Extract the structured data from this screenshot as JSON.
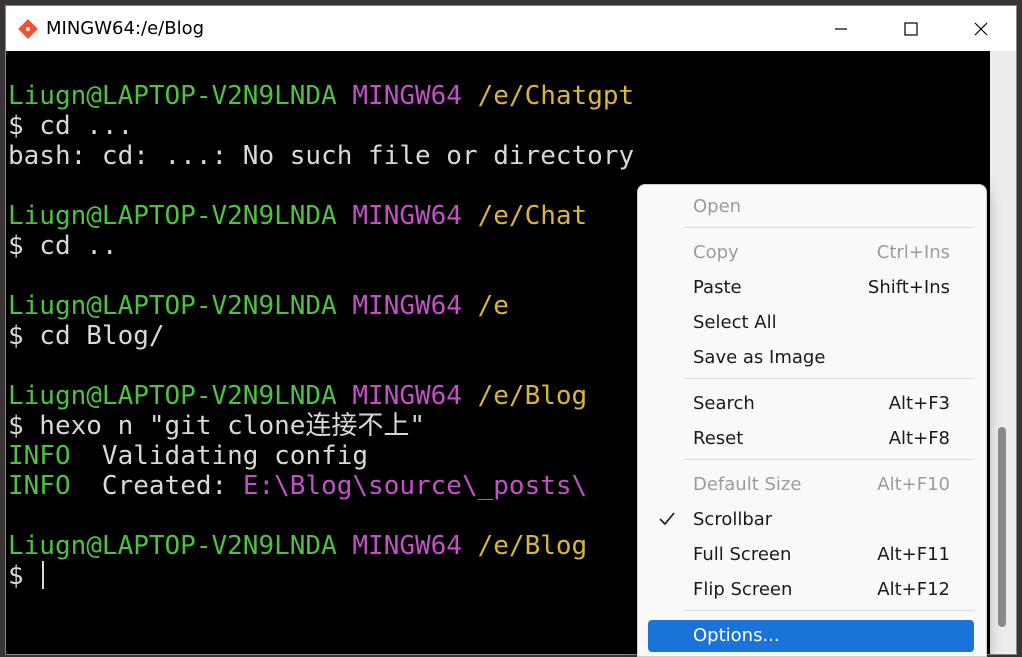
{
  "window": {
    "title": "MINGW64:/e/Blog",
    "minimize_icon": "minimize-icon",
    "maximize_icon": "maximize-icon",
    "close_icon": "close-icon"
  },
  "terminal": {
    "lines": [
      {
        "segments": [
          {
            "text": "Liugn@LAPTOP-V2N9LNDA",
            "color": "green"
          },
          {
            "text": " MINGW64",
            "color": "magenta"
          },
          {
            "text": " /e/Chatgpt",
            "color": "yellow"
          }
        ]
      },
      {
        "segments": [
          {
            "text": "$ cd ...",
            "color": "white"
          }
        ]
      },
      {
        "segments": [
          {
            "text": "bash: cd: ...: No such file or directory",
            "color": "white"
          }
        ]
      },
      {
        "segments": []
      },
      {
        "segments": [
          {
            "text": "Liugn@LAPTOP-V2N9LNDA",
            "color": "green"
          },
          {
            "text": " MINGW64",
            "color": "magenta"
          },
          {
            "text": " /e/Chat",
            "color": "yellow"
          }
        ]
      },
      {
        "segments": [
          {
            "text": "$ cd ..",
            "color": "white"
          }
        ]
      },
      {
        "segments": []
      },
      {
        "segments": [
          {
            "text": "Liugn@LAPTOP-V2N9LNDA",
            "color": "green"
          },
          {
            "text": " MINGW64",
            "color": "magenta"
          },
          {
            "text": " /e",
            "color": "yellow"
          }
        ]
      },
      {
        "segments": [
          {
            "text": "$ cd Blog/",
            "color": "white"
          }
        ]
      },
      {
        "segments": []
      },
      {
        "segments": [
          {
            "text": "Liugn@LAPTOP-V2N9LNDA",
            "color": "green"
          },
          {
            "text": " MINGW64",
            "color": "magenta"
          },
          {
            "text": " /e/Blog",
            "color": "yellow"
          }
        ]
      },
      {
        "segments": [
          {
            "text": "$ hexo n \"git clone连接不上\"",
            "color": "white"
          }
        ]
      },
      {
        "segments": [
          {
            "text": "INFO",
            "color": "green"
          },
          {
            "text": "  Validating config",
            "color": "white"
          }
        ]
      },
      {
        "segments": [
          {
            "text": "INFO",
            "color": "green"
          },
          {
            "text": "  Created: ",
            "color": "white"
          },
          {
            "text": "E:\\Blog\\source\\_posts\\",
            "color": "magenta"
          }
        ]
      },
      {
        "segments": []
      },
      {
        "segments": [
          {
            "text": "Liugn@LAPTOP-V2N9LNDA",
            "color": "green"
          },
          {
            "text": " MINGW64",
            "color": "magenta"
          },
          {
            "text": " /e/Blog",
            "color": "yellow"
          }
        ]
      },
      {
        "segments": [
          {
            "text": "$ ",
            "color": "white"
          }
        ],
        "cursor": true
      }
    ],
    "colors": {
      "green": "#4ec240",
      "magenta": "#c450c8",
      "yellow": "#d8b638",
      "white": "#d8d8d8",
      "background": "#000000"
    }
  },
  "context_menu": {
    "items": [
      {
        "label": "Open",
        "shortcut": "",
        "disabled": true
      },
      {
        "label": "Copy",
        "shortcut": "Ctrl+Ins",
        "disabled": true
      },
      {
        "label": "Paste",
        "shortcut": "Shift+Ins",
        "disabled": false
      },
      {
        "label": "Select All",
        "shortcut": "",
        "disabled": false
      },
      {
        "label": "Save as Image",
        "shortcut": "",
        "disabled": false
      },
      {
        "label": "Search",
        "shortcut": "Alt+F3",
        "disabled": false
      },
      {
        "label": "Reset",
        "shortcut": "Alt+F8",
        "disabled": false
      },
      {
        "label": "Default Size",
        "shortcut": "Alt+F10",
        "disabled": true
      },
      {
        "label": "Scrollbar",
        "shortcut": "",
        "disabled": false,
        "checked": true
      },
      {
        "label": "Full Screen",
        "shortcut": "Alt+F11",
        "disabled": false
      },
      {
        "label": "Flip Screen",
        "shortcut": "Alt+F12",
        "disabled": false
      },
      {
        "label": "Options...",
        "shortcut": "",
        "disabled": false,
        "highlighted": true
      }
    ],
    "highlight_color": "#1a73d6"
  }
}
